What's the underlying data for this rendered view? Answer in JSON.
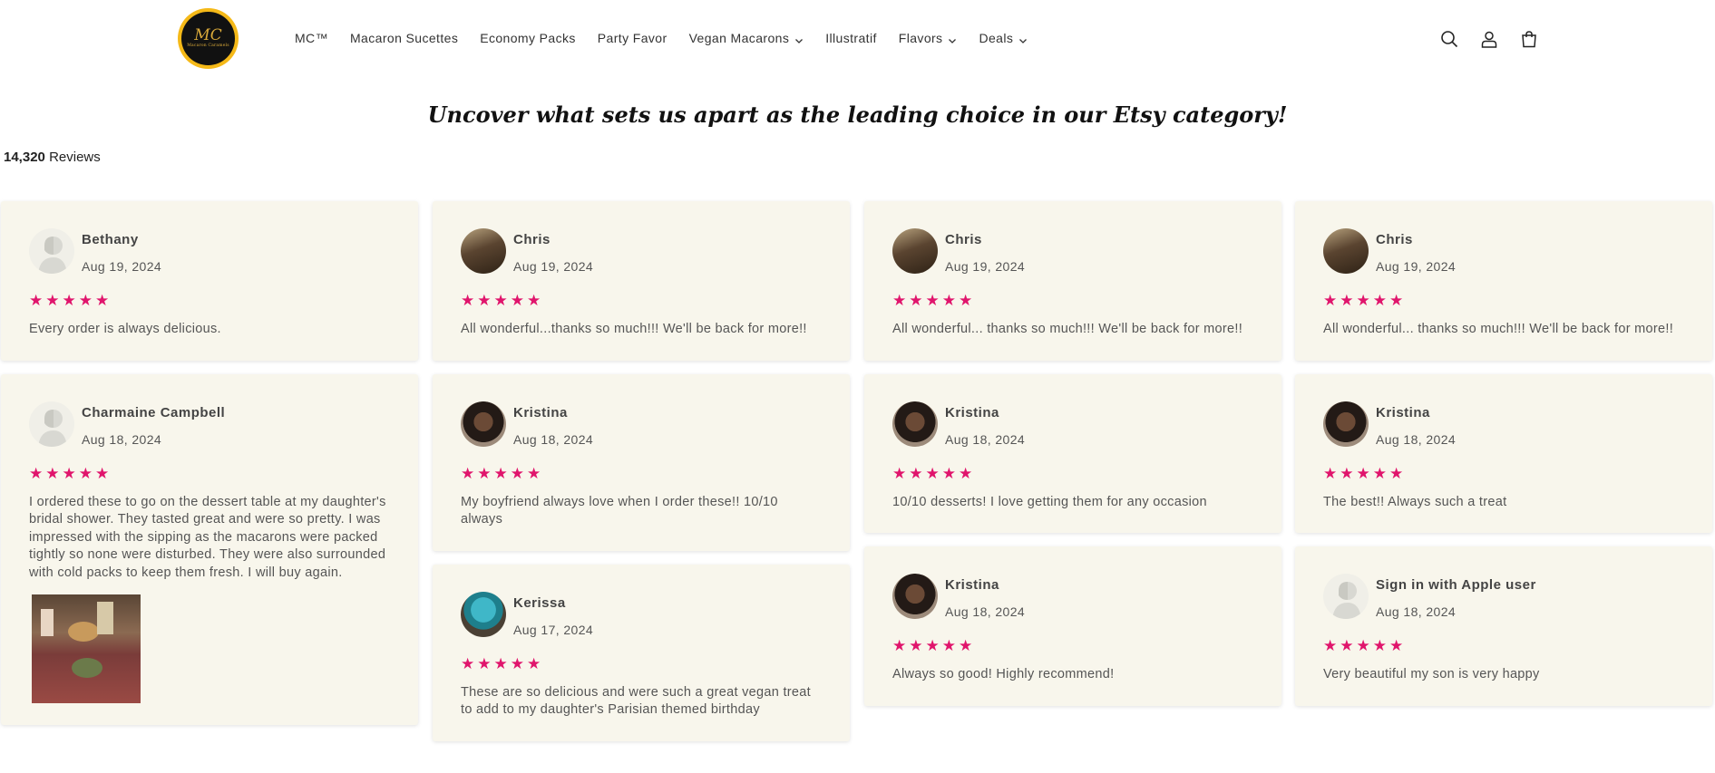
{
  "logo": {
    "mark": "MC",
    "text": "Macaron Caramels"
  },
  "nav": [
    {
      "label": "MC™",
      "dropdown": false
    },
    {
      "label": "Macaron Sucettes",
      "dropdown": false
    },
    {
      "label": "Economy Packs",
      "dropdown": false
    },
    {
      "label": "Party Favor",
      "dropdown": false
    },
    {
      "label": "Vegan Macarons",
      "dropdown": true
    },
    {
      "label": "Illustratif",
      "dropdown": false
    },
    {
      "label": "Flavors",
      "dropdown": true
    },
    {
      "label": "Deals",
      "dropdown": true
    }
  ],
  "header_icons": [
    "search-icon",
    "account-icon",
    "cart-icon"
  ],
  "headline": "Uncover what sets us apart as the leading choice in our Etsy category!",
  "reviews_summary": {
    "count": "14,320",
    "label": "Reviews"
  },
  "colors": {
    "star": "#e0156c",
    "card_bg": "#f8f6ec",
    "logo_ring": "#f5b918"
  },
  "columns": [
    [
      {
        "name": "Bethany",
        "date": "Aug 19, 2024",
        "rating": 5,
        "text": "Every order is always delicious.",
        "avatar": "default"
      },
      {
        "name": "Charmaine Campbell",
        "date": "Aug 18, 2024",
        "rating": 5,
        "text": "I ordered these to go on the dessert table at my daughter's bridal shower. They tasted great and were so pretty. I was impressed with the sipping as the macarons were packed tightly so none were disturbed. They were also surrounded with cold packs to keep them fresh. I will buy again.",
        "avatar": "default",
        "photo": true
      }
    ],
    [
      {
        "name": "Chris",
        "date": "Aug 19, 2024",
        "rating": 5,
        "text": "All wonderful...thanks so much!!! We'll be back for more!!",
        "avatar": "chris"
      },
      {
        "name": "Kristina",
        "date": "Aug 18, 2024",
        "rating": 5,
        "text": "My boyfriend always love when I order these!! 10/10 always",
        "avatar": "kristina"
      },
      {
        "name": "Kerissa",
        "date": "Aug 17, 2024",
        "rating": 5,
        "text": "These are so delicious and were such a great vegan treat to add to my daughter's Parisian themed birthday",
        "avatar": "kerissa"
      }
    ],
    [
      {
        "name": "Chris",
        "date": "Aug 19, 2024",
        "rating": 5,
        "text": "All wonderful... thanks so much!!! We'll be back for more!!",
        "avatar": "chris"
      },
      {
        "name": "Kristina",
        "date": "Aug 18, 2024",
        "rating": 5,
        "text": "10/10 desserts! I love getting them for any occasion",
        "avatar": "kristina"
      },
      {
        "name": "Kristina",
        "date": "Aug 18, 2024",
        "rating": 5,
        "text": "Always so good! Highly recommend!",
        "avatar": "kristina"
      }
    ],
    [
      {
        "name": "Chris",
        "date": "Aug 19, 2024",
        "rating": 5,
        "text": "All wonderful... thanks so much!!! We'll be back for more!!",
        "avatar": "chris"
      },
      {
        "name": "Kristina",
        "date": "Aug 18, 2024",
        "rating": 5,
        "text": "The best!! Always such a treat",
        "avatar": "kristina"
      },
      {
        "name": "Sign in with Apple user",
        "date": "Aug 18, 2024",
        "rating": 5,
        "text": "Very beautiful my son is very happy",
        "avatar": "default"
      }
    ]
  ]
}
